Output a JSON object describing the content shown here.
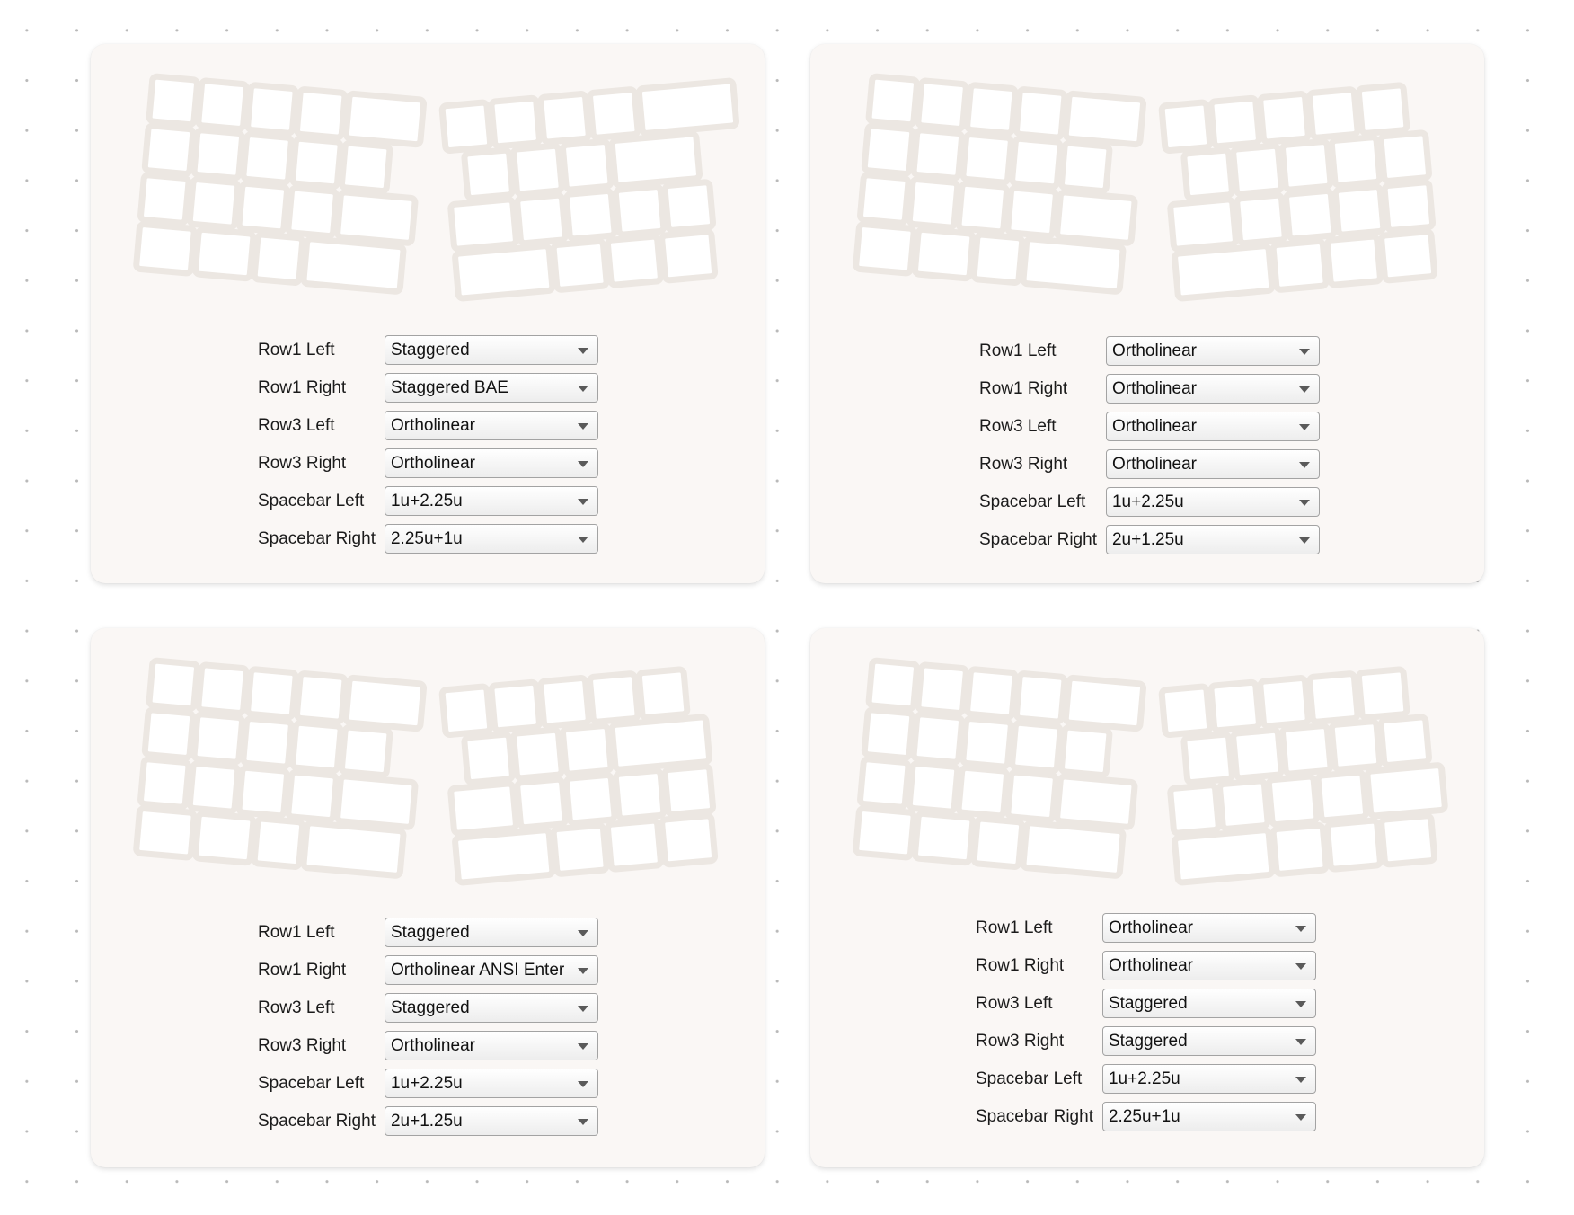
{
  "panels": [
    {
      "right_row1_layout": "bae",
      "right_row3_layout": "ortho",
      "fields": [
        {
          "label": "Row1 Left",
          "value": "Staggered"
        },
        {
          "label": "Row1 Right",
          "value": "Staggered BAE"
        },
        {
          "label": "Row3 Left",
          "value": "Ortholinear"
        },
        {
          "label": "Row3 Right",
          "value": "Ortholinear"
        },
        {
          "label": "Spacebar Left",
          "value": "1u+2.25u"
        },
        {
          "label": "Spacebar Right",
          "value": "2.25u+1u"
        }
      ]
    },
    {
      "right_row1_layout": "ortho",
      "right_row3_layout": "ortho",
      "fields": [
        {
          "label": "Row1 Left",
          "value": "Ortholinear"
        },
        {
          "label": "Row1 Right",
          "value": "Ortholinear"
        },
        {
          "label": "Row3 Left",
          "value": "Ortholinear"
        },
        {
          "label": "Row3 Right",
          "value": "Ortholinear"
        },
        {
          "label": "Spacebar Left",
          "value": "1u+2.25u"
        },
        {
          "label": "Spacebar Right",
          "value": "2u+1.25u"
        }
      ]
    },
    {
      "right_row1_layout": "ansi-enter",
      "right_row3_layout": "ortho",
      "fields": [
        {
          "label": "Row1 Left",
          "value": "Staggered"
        },
        {
          "label": "Row1 Right",
          "value": "Ortholinear ANSI Enter"
        },
        {
          "label": "Row3 Left",
          "value": "Staggered"
        },
        {
          "label": "Row3 Right",
          "value": "Ortholinear"
        },
        {
          "label": "Spacebar Left",
          "value": "1u+2.25u"
        },
        {
          "label": "Spacebar Right",
          "value": "2u+1.25u"
        }
      ]
    },
    {
      "right_row1_layout": "ortho",
      "right_row3_layout": "staggered",
      "fields": [
        {
          "label": "Row1 Left",
          "value": "Ortholinear"
        },
        {
          "label": "Row1 Right",
          "value": "Ortholinear"
        },
        {
          "label": "Row3 Left",
          "value": "Staggered"
        },
        {
          "label": "Row3 Right",
          "value": "Staggered"
        },
        {
          "label": "Spacebar Left",
          "value": "1u+2.25u"
        },
        {
          "label": "Spacebar Right",
          "value": "2.25u+1u"
        }
      ]
    }
  ],
  "colors": {
    "card": "#faf7f5",
    "key": "#ffffff",
    "key_border": "#ece7e2"
  },
  "icons": {
    "select_arrow": "triangle-down-icon"
  }
}
